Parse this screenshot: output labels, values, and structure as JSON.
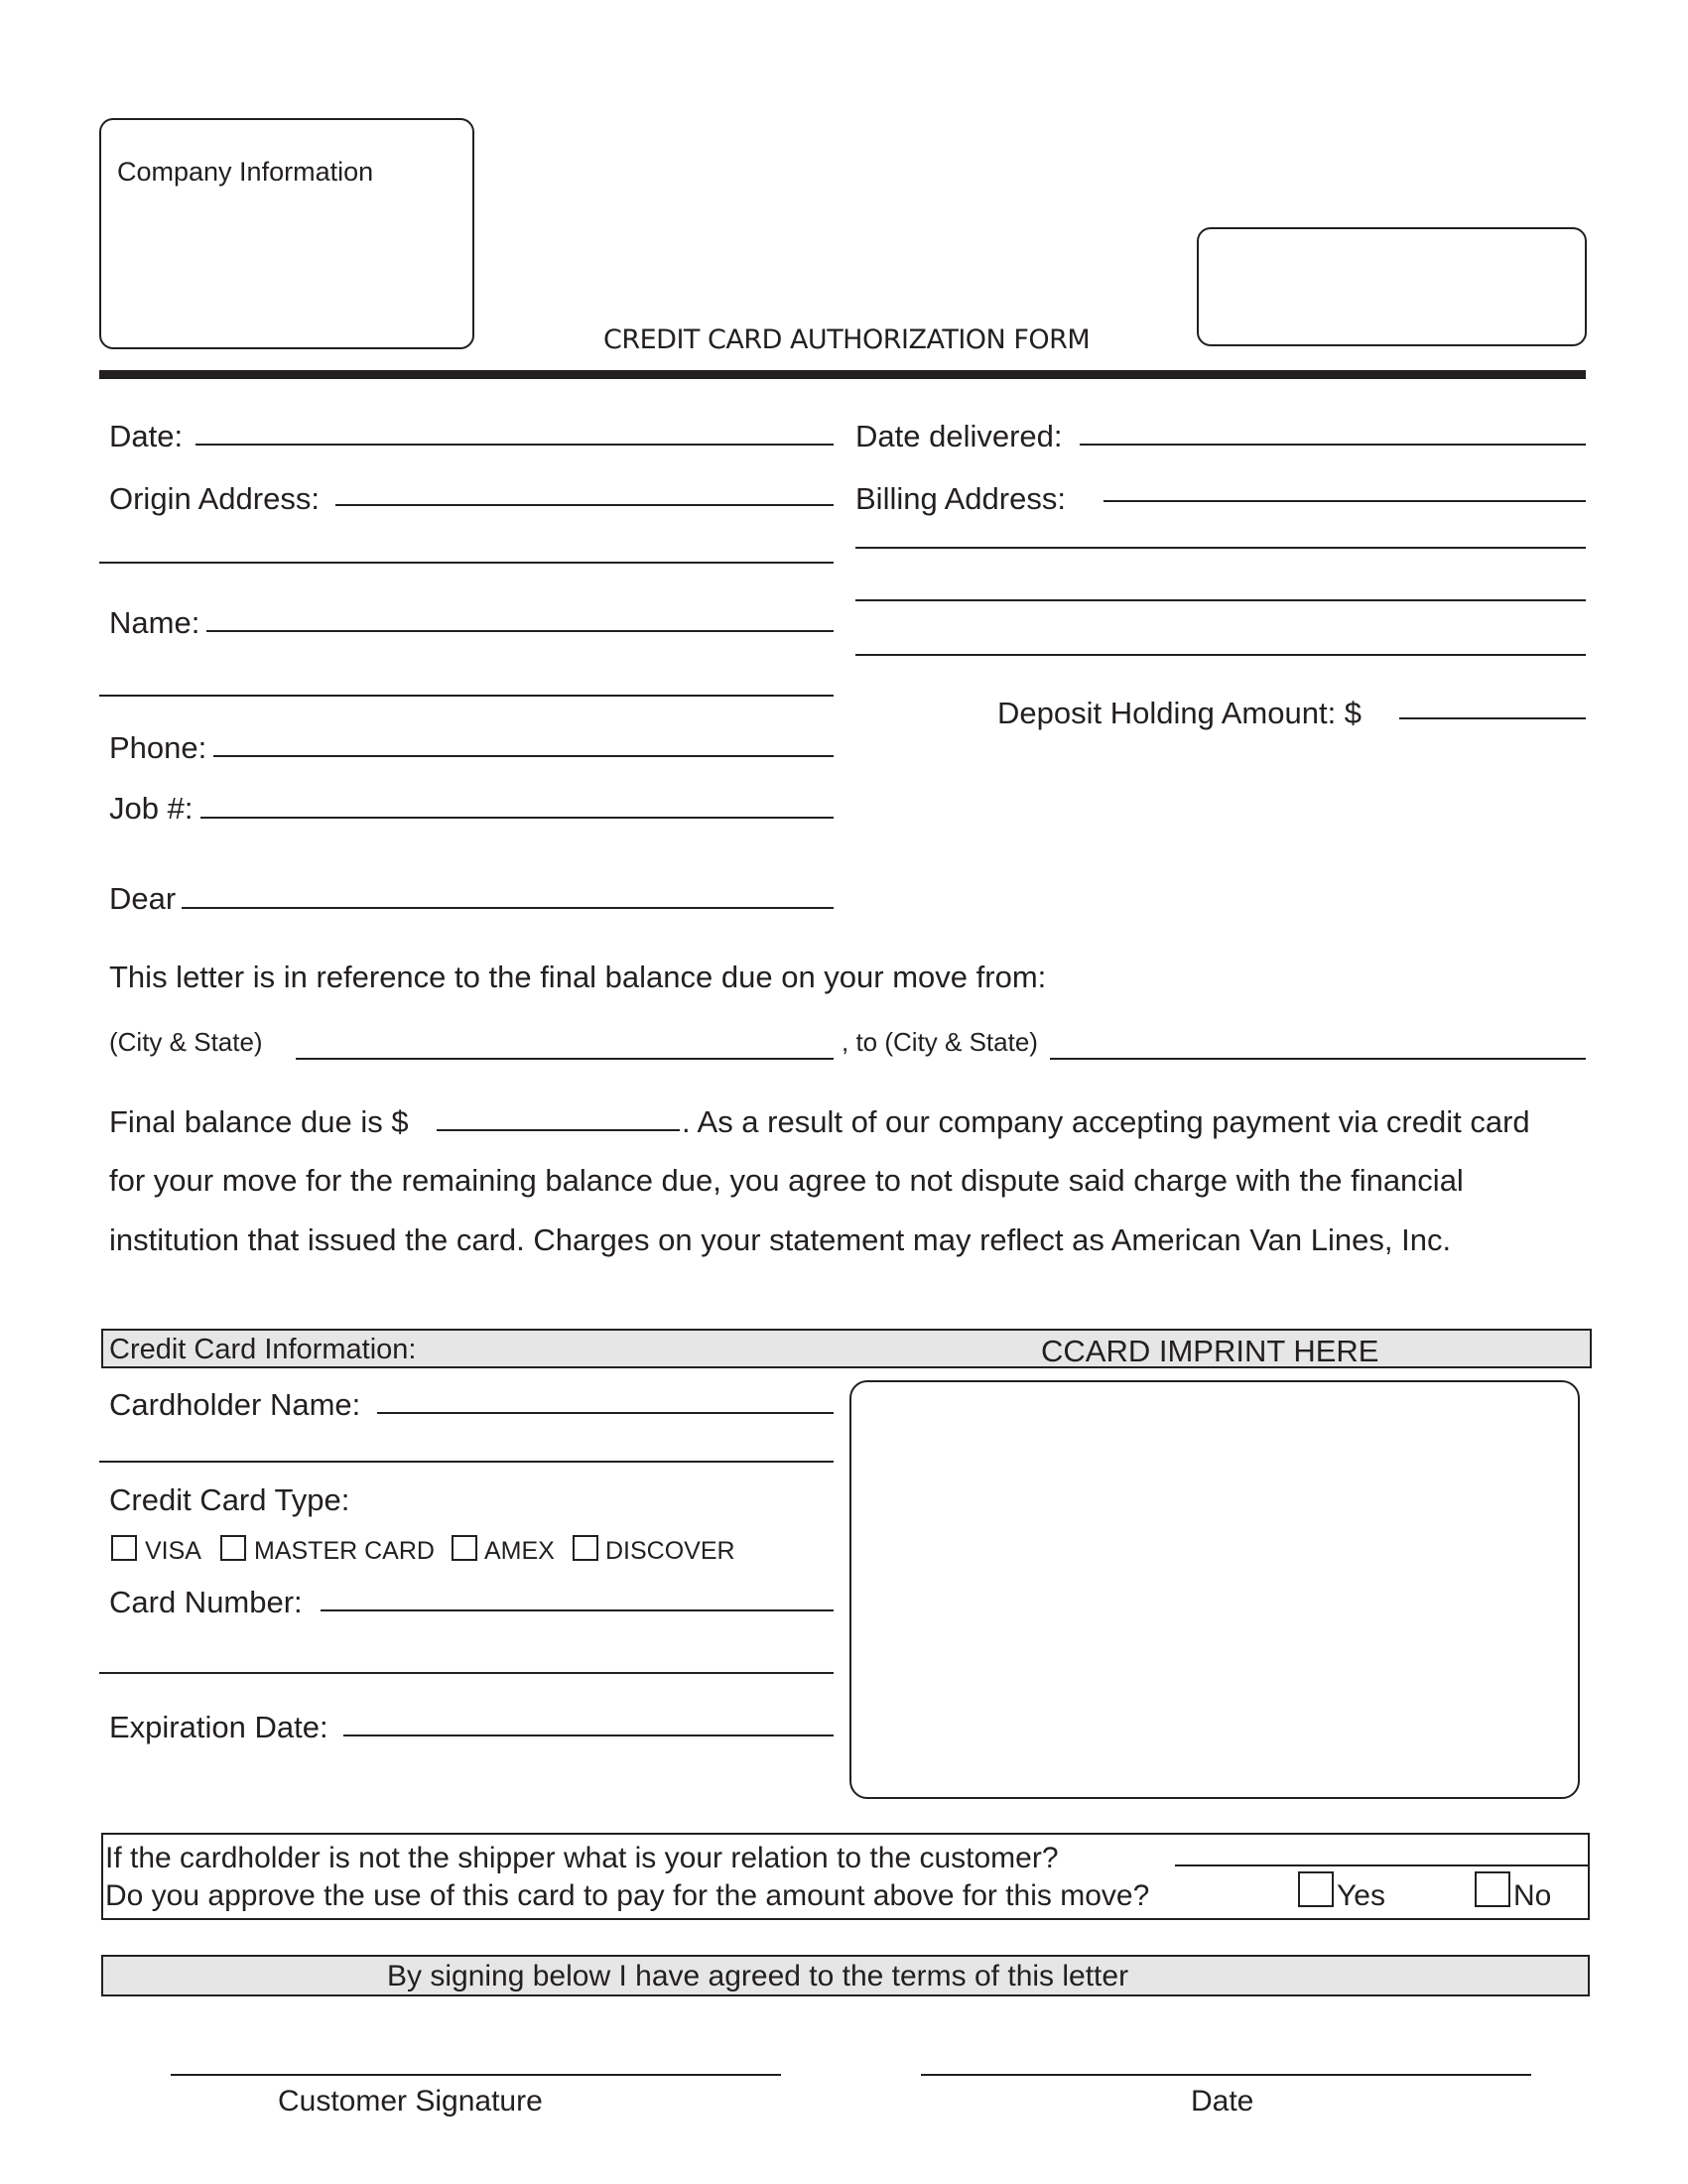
{
  "header": {
    "company_info_label": "Company Information",
    "form_title": "CREDIT CARD AUTHORIZATION FORM"
  },
  "fields": {
    "date": "Date:",
    "date_delivered": "Date delivered:",
    "origin_address": "Origin Address:",
    "billing_address": "Billing Address:",
    "name": "Name:",
    "deposit_holding_amount": "Deposit Holding Amount: $",
    "phone": "Phone:",
    "job_number": "Job #:",
    "dear": "Dear"
  },
  "letter": {
    "intro": "This letter is in reference to the final balance due on your move from:",
    "from_city_state": "(City & State)",
    "to_city_state": ", to (City & State)",
    "final_balance_prefix": "Final balance due is $",
    "final_balance_suffix": ". As a result of our company accepting payment via credit card",
    "line2": "for your move for the remaining balance due, you agree to not dispute said charge with the financial",
    "line3": "institution that issued the card. Charges on your statement may reflect as American Van Lines, Inc."
  },
  "credit_card": {
    "section_label": "Credit Card Information:",
    "imprint_label": "CCARD IMPRINT HERE",
    "cardholder_name": "Cardholder Name:",
    "card_type_label": "Credit Card Type:",
    "card_types": [
      "VISA",
      "MASTER CARD",
      "AMEX",
      "DISCOVER"
    ],
    "card_number": "Card Number:",
    "expiration_date": "Expiration Date:"
  },
  "relation": {
    "question": "If the cardholder is not the shipper what is your relation to the customer?",
    "approve_question": "Do you approve the use of this card to pay for the amount above for this move?",
    "yes_label": "Yes",
    "no_label": "No"
  },
  "agreement": {
    "text": "By signing below I have agreed to the terms of this letter"
  },
  "signatures": {
    "customer_signature": "Customer Signature",
    "date": "Date"
  }
}
